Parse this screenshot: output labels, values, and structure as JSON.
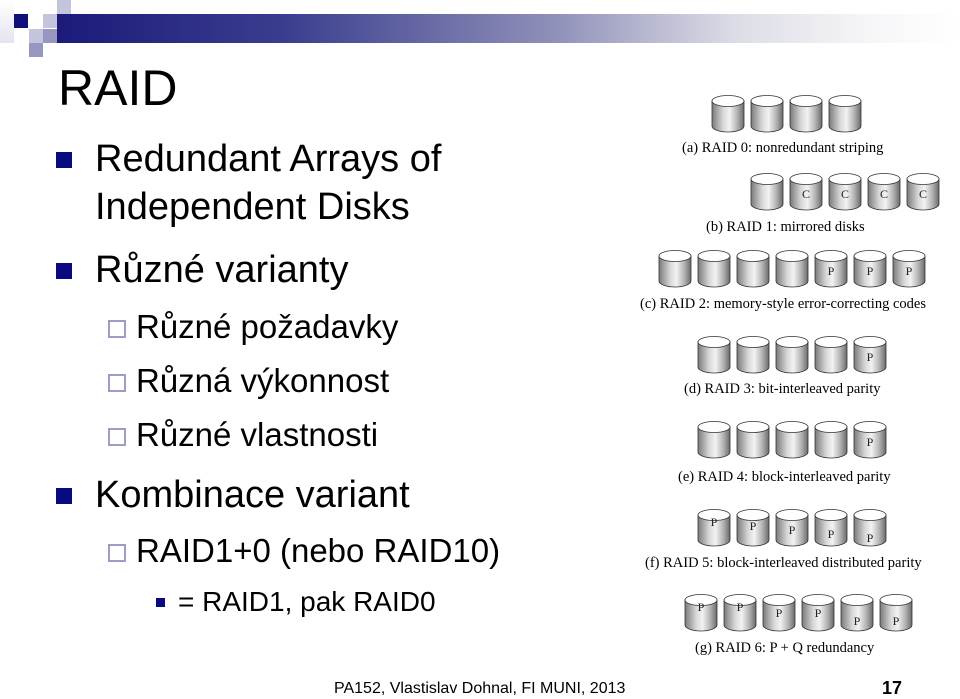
{
  "slide": {
    "title": "RAID",
    "bullets": [
      {
        "level": 1,
        "text_lines": [
          "Redundant Arrays of",
          "Independent Disks"
        ]
      },
      {
        "level": 1,
        "text_lines": [
          "Různé varianty"
        ]
      },
      {
        "level": 2,
        "text_lines": [
          "Různé požadavky"
        ]
      },
      {
        "level": 2,
        "text_lines": [
          "Různá výkonnost"
        ]
      },
      {
        "level": 2,
        "text_lines": [
          "Různé vlastnosti"
        ]
      },
      {
        "level": 1,
        "text_lines": [
          "Kombinace variant"
        ]
      },
      {
        "level": 2,
        "text_lines": [
          "RAID1+0 (nebo RAID10)"
        ]
      },
      {
        "level": 3,
        "text_lines": [
          "= RAID1, pak RAID0"
        ]
      }
    ],
    "footer": "PA152, Vlastislav Dohnal, FI MUNI, 2013",
    "page_number": "17",
    "colors": {
      "bullet": "#0a0a80",
      "sub_bullet_border": "#9c9cc8",
      "header_bar": "#1c1a7a"
    }
  },
  "figure": {
    "rows": [
      {
        "caption": "(a) RAID 0: nonredundant striping",
        "disks": [
          "",
          "",
          "",
          ""
        ]
      },
      {
        "caption": "(b) RAID 1: mirrored disks",
        "disks": [
          "",
          "C",
          "C",
          "C",
          "C"
        ]
      },
      {
        "caption": "(c) RAID 2: memory-style error-correcting codes",
        "disks": [
          "",
          "",
          "",
          "",
          "P",
          "P",
          "P"
        ]
      },
      {
        "caption": "(d) RAID 3: bit-interleaved parity",
        "disks": [
          "",
          "",
          "",
          "",
          "P"
        ]
      },
      {
        "caption": "(e) RAID 4: block-interleaved parity",
        "disks": [
          "",
          "",
          "",
          "",
          "P"
        ]
      },
      {
        "caption": "(f) RAID 5: block-interleaved distributed parity",
        "disks": [
          "P",
          "P",
          "P",
          "P",
          "P"
        ]
      },
      {
        "caption": "(g) RAID 6: P + Q redundancy",
        "disks": [
          "P",
          "P",
          "P",
          "P",
          "P",
          "P"
        ]
      }
    ]
  }
}
